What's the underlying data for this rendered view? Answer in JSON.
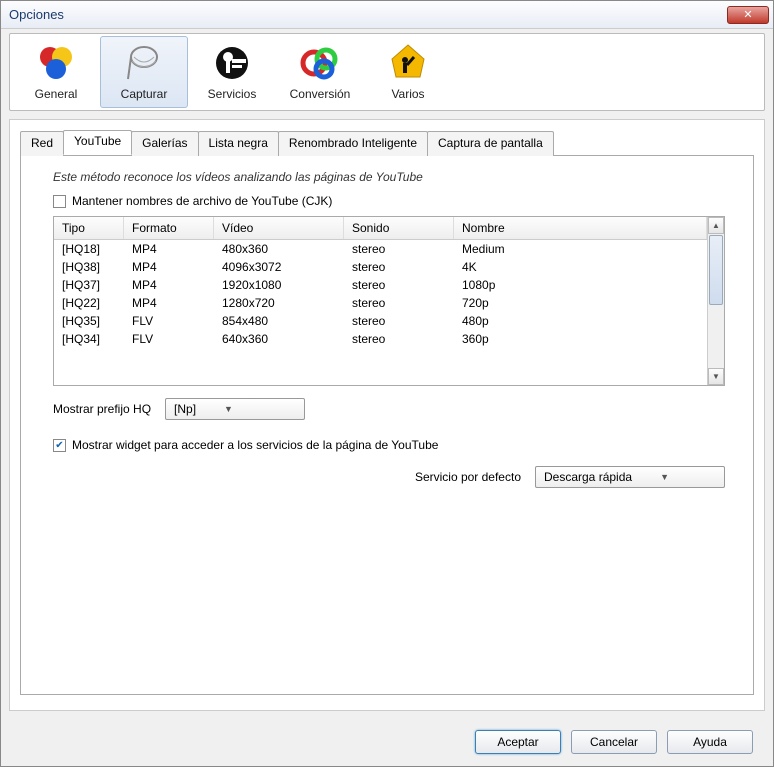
{
  "window": {
    "title": "Opciones"
  },
  "toolbar": {
    "items": [
      {
        "label": "General"
      },
      {
        "label": "Capturar"
      },
      {
        "label": "Servicios"
      },
      {
        "label": "Conversión"
      },
      {
        "label": "Varios"
      }
    ]
  },
  "tabs": [
    {
      "label": "Red"
    },
    {
      "label": "YouTube"
    },
    {
      "label": "Galerías"
    },
    {
      "label": "Lista negra"
    },
    {
      "label": "Renombrado Inteligente"
    },
    {
      "label": "Captura de pantalla"
    }
  ],
  "youtube": {
    "description": "Este método reconoce los vídeos analizando las páginas de YouTube",
    "keep_names_label": "Mantener nombres de archivo de YouTube (CJK)",
    "columns": {
      "tipo": "Tipo",
      "formato": "Formato",
      "video": "Vídeo",
      "sonido": "Sonido",
      "nombre": "Nombre"
    },
    "rows": [
      {
        "tipo": "[HQ18]",
        "formato": "MP4",
        "video": "480x360",
        "sonido": "stereo",
        "nombre": "Medium"
      },
      {
        "tipo": "[HQ38]",
        "formato": "MP4",
        "video": "4096x3072",
        "sonido": "stereo",
        "nombre": "4K"
      },
      {
        "tipo": "[HQ37]",
        "formato": "MP4",
        "video": "1920x1080",
        "sonido": "stereo",
        "nombre": "1080p"
      },
      {
        "tipo": "[HQ22]",
        "formato": "MP4",
        "video": "1280x720",
        "sonido": "stereo",
        "nombre": "720p"
      },
      {
        "tipo": "[HQ35]",
        "formato": "FLV",
        "video": "854x480",
        "sonido": "stereo",
        "nombre": "480p"
      },
      {
        "tipo": "[HQ34]",
        "formato": "FLV",
        "video": "640x360",
        "sonido": "stereo",
        "nombre": "360p"
      }
    ],
    "prefix_label": "Mostrar prefijo HQ",
    "prefix_value": "[Np]",
    "widget_label": "Mostrar widget para acceder a los servicios de la página de YouTube",
    "service_label": "Servicio por defecto",
    "service_value": "Descarga rápida"
  },
  "buttons": {
    "ok": "Aceptar",
    "cancel": "Cancelar",
    "help": "Ayuda"
  }
}
